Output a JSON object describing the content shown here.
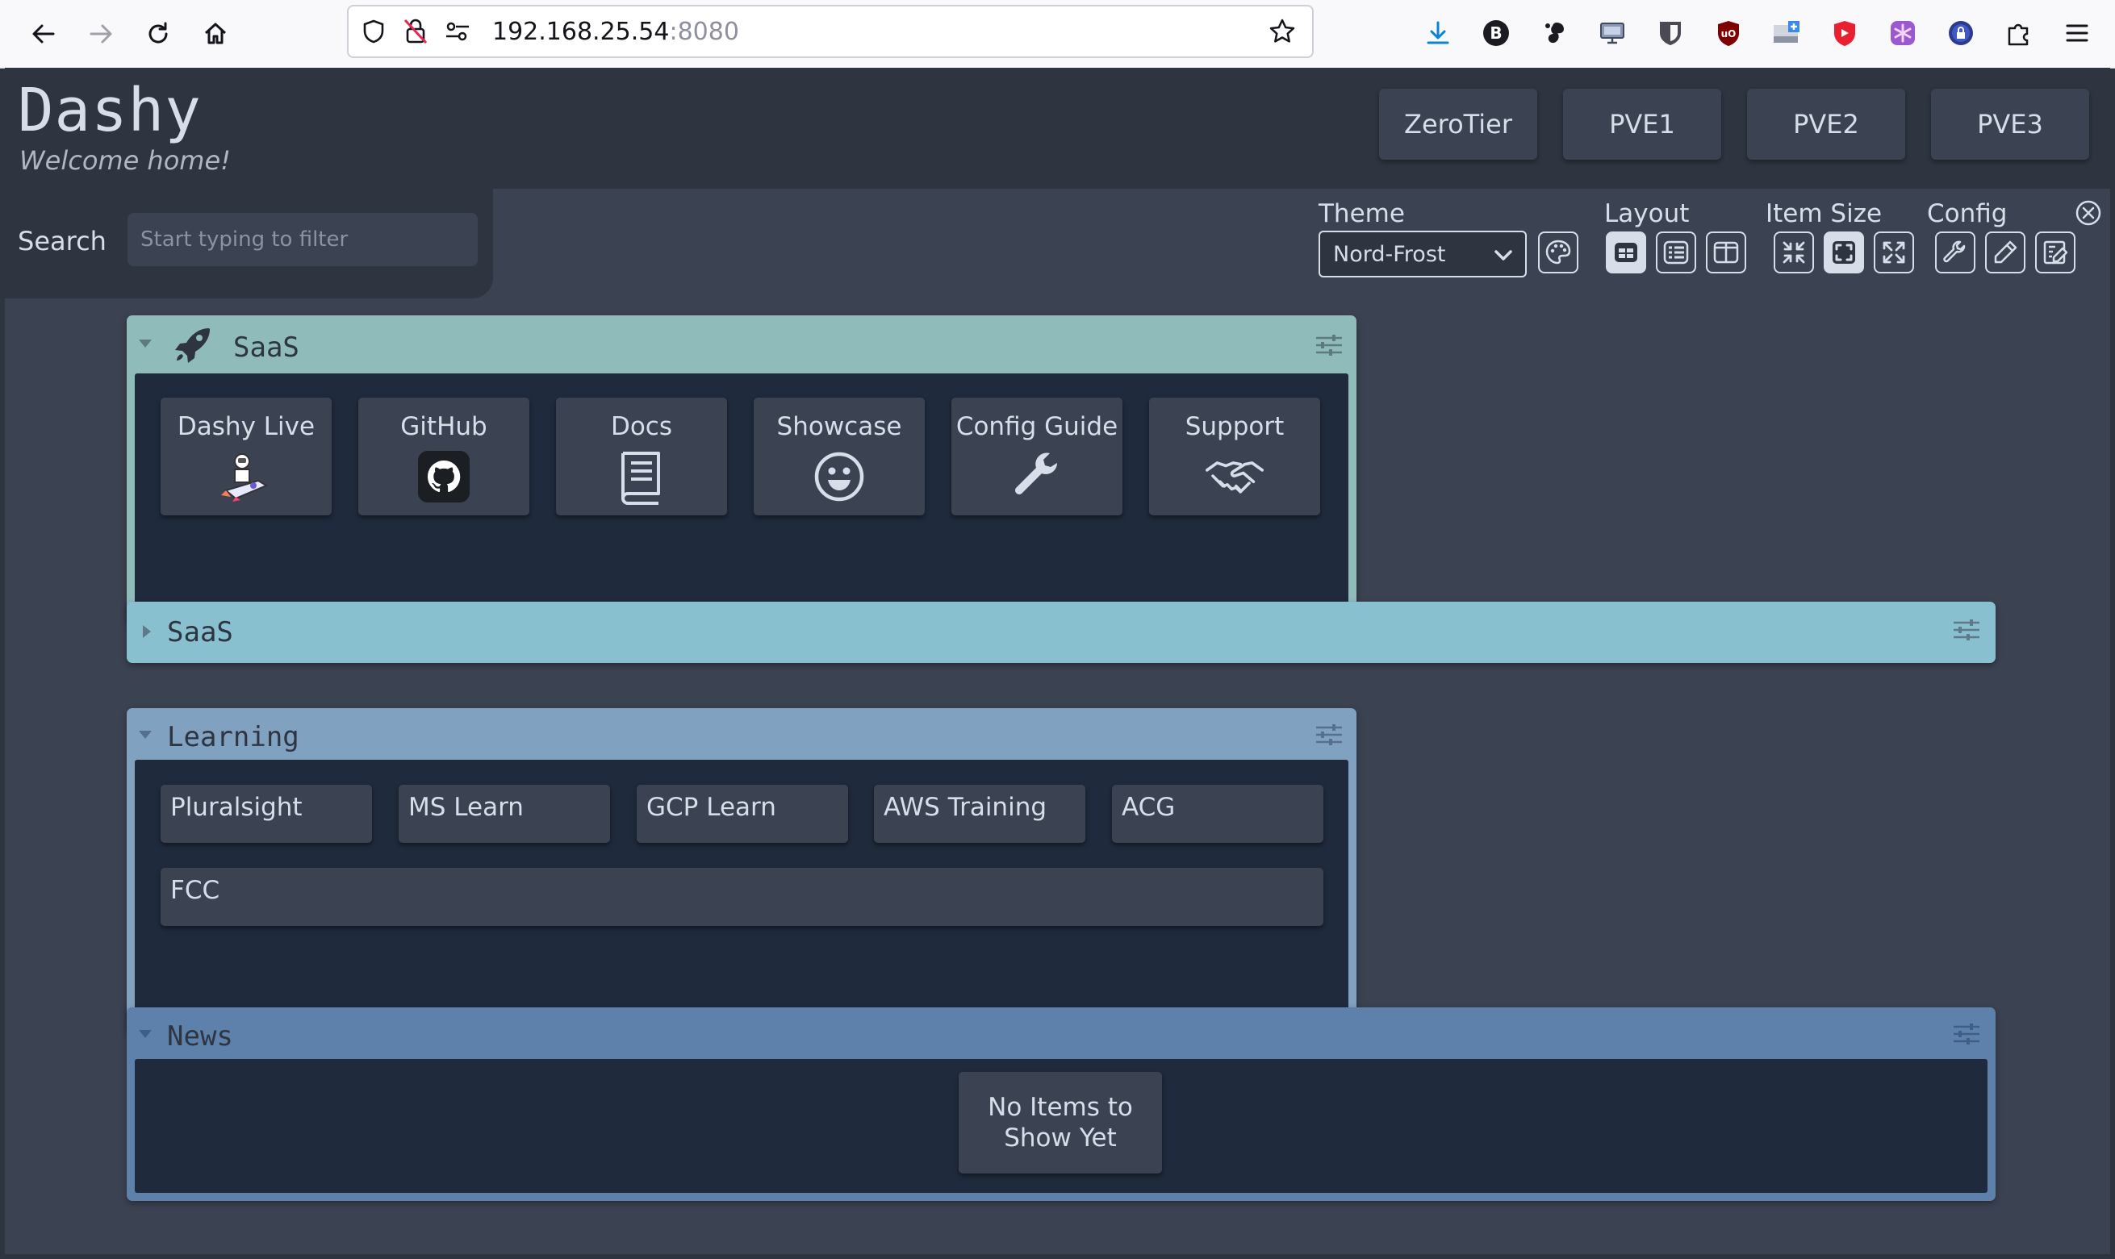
{
  "browser": {
    "url_host": "192.168.25.54",
    "url_port": ":8080",
    "extensions": [
      "download-icon",
      "b-extension-icon",
      "gnome-icon",
      "monitor-icon",
      "bitwarden-icon",
      "ublock-icon",
      "tab-plus-icon",
      "shield-heart-icon",
      "purple-snowflake-icon",
      "vpn-lock-icon",
      "puzzle-icon"
    ]
  },
  "app": {
    "title": "Dashy",
    "subtitle": "Welcome home!",
    "nav_links": [
      "ZeroTier",
      "PVE1",
      "PVE2",
      "PVE3"
    ]
  },
  "search": {
    "label": "Search",
    "placeholder": "Start typing to filter"
  },
  "settings": {
    "theme_label": "Theme",
    "theme_value": "Nord-Frost",
    "layout_label": "Layout",
    "item_size_label": "Item Size",
    "config_label": "Config"
  },
  "sections": {
    "saas_open": {
      "title": "SaaS",
      "items": [
        {
          "label": "Dashy Live",
          "icon": "astronaut-rocket-icon"
        },
        {
          "label": "GitHub",
          "icon": "github-icon"
        },
        {
          "label": "Docs",
          "icon": "book-icon"
        },
        {
          "label": "Showcase",
          "icon": "smiley-icon"
        },
        {
          "label": "Config Guide",
          "icon": "wrench-icon"
        },
        {
          "label": "Support",
          "icon": "handshake-icon"
        }
      ]
    },
    "saas_collapsed": {
      "title": "SaaS"
    },
    "learning": {
      "title": "Learning",
      "items": [
        "Pluralsight",
        "MS Learn",
        "GCP Learn",
        "AWS Training",
        "ACG",
        "FCC"
      ]
    },
    "news": {
      "title": "News",
      "empty_line1": "No Items to",
      "empty_line2": "Show Yet"
    }
  },
  "colors": {
    "background": "#3b4252",
    "header": "#2e3440",
    "saas_open_accent": "#8fbcbb",
    "saas_collapsed_accent": "#88c0d0",
    "learning_accent": "#81a1c1",
    "news_accent": "#5e81ac",
    "text": "#d8dee9"
  }
}
